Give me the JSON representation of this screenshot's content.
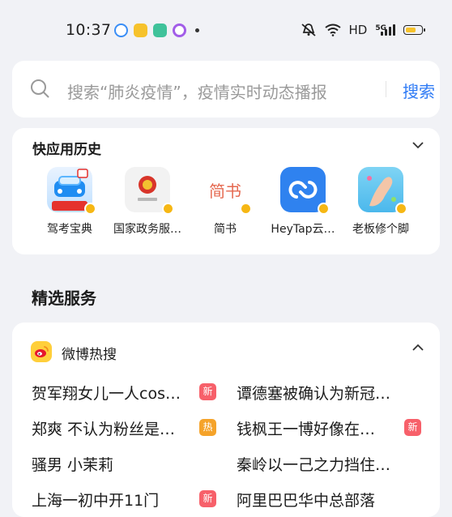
{
  "status_bar": {
    "time": "10:37",
    "network": "HD",
    "network_gen": "5G",
    "battery_level": 0.7,
    "colors": {
      "battery": "#f6c22b"
    }
  },
  "search": {
    "placeholder": "搜索“肺炎疫情”，疫情实时动态播报",
    "button": "搜索",
    "accent": "#2f7bf5"
  },
  "quick_apps": {
    "title": "快应用历史",
    "items": [
      {
        "label": "驾考宝典",
        "icon": "car-icon"
      },
      {
        "label": "国家政务服…",
        "icon": "emblem-icon"
      },
      {
        "label": "简书",
        "icon": "jianshu-icon",
        "icon_text": "简书"
      },
      {
        "label": "HeyTap云…",
        "icon": "cloud-icon"
      },
      {
        "label": "老板修个脚",
        "icon": "foot-icon"
      }
    ]
  },
  "featured": {
    "title": "精选服务",
    "weibo": {
      "title": "微博热搜",
      "items": [
        {
          "text": "贺军翔女儿一人cos…",
          "badge": "新",
          "badge_color": "#f7606a"
        },
        {
          "text": "谭德塞被确认为新冠…",
          "badge": "",
          "badge_color": ""
        },
        {
          "text": "郑爽 不认为粉丝是…",
          "badge": "热",
          "badge_color": "#f5a32a"
        },
        {
          "text": "钱枫王一博好像在…",
          "badge": "新",
          "badge_color": "#f7606a"
        },
        {
          "text": "骚男 小茉莉",
          "badge": "",
          "badge_color": ""
        },
        {
          "text": "秦岭以一己之力挡住…",
          "badge": "",
          "badge_color": ""
        },
        {
          "text": "上海一初中开11门",
          "badge": "新",
          "badge_color": "#f7606a"
        },
        {
          "text": "阿里巴巴华中总部落",
          "badge": "",
          "badge_color": ""
        }
      ]
    }
  }
}
